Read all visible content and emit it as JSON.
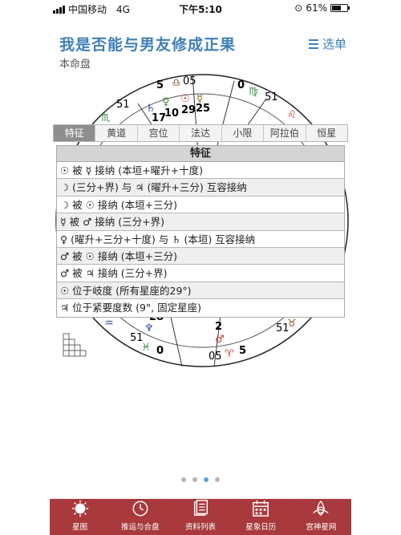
{
  "status_bar": {
    "carrier": "中国移动",
    "network": "4G",
    "time": "下午5:10",
    "battery": "61%",
    "battery_level": 0.61
  },
  "header": {
    "title": "我是否能与男友修成正果",
    "subtitle": "本命盘",
    "menu_label": "选单"
  },
  "chart": {
    "numbers": [
      "5",
      "05",
      "0",
      "51",
      "10",
      "17",
      "29",
      "25",
      "51",
      "51",
      "28",
      "2",
      "0",
      "05",
      "5",
      "51"
    ],
    "signs": [
      "♎",
      "♍",
      "♌",
      "♏",
      "♒",
      "♓",
      "♈",
      "♉"
    ],
    "planets": [
      "♄",
      "♀",
      "☉",
      "☿",
      "♆",
      "♂"
    ]
  },
  "tabs": [
    "特征",
    "黄道",
    "宫位",
    "法达",
    "小限",
    "阿拉伯",
    "恒星"
  ],
  "table": {
    "header": "特征",
    "rows": [
      "☉ 被 ☿ 接纳 (本垣+曜升+十度)",
      "☽ (三分+界) 与 ♃ (曜升+三分) 互容接纳",
      "☽ 被 ☉ 接纳 (本垣+三分)",
      "☿ 被 ♂ 接纳 (三分+界)",
      "♀ (曜升+三分+十度) 与 ♄ (本垣) 互容接纳",
      "♂ 被 ☉ 接纳 (本垣+三分)",
      "♂ 被 ♃ 接纳 (三分+界)",
      "☉ 位于岐度 (所有星座的29°)",
      "♃ 位于紧要度数 (9°, 固定星座)"
    ]
  },
  "pagination": {
    "active_index": 2,
    "count": 4
  },
  "bottom_nav": [
    {
      "label": "星图",
      "icon": "sun-icon"
    },
    {
      "label": "推运与合盘",
      "icon": "clock-icon"
    },
    {
      "label": "资料列表",
      "icon": "document-icon"
    },
    {
      "label": "星象日历",
      "icon": "calendar-icon"
    },
    {
      "label": "宫神星网",
      "icon": "triquetra-icon"
    }
  ],
  "colors": {
    "accent": "#3f7fb8",
    "nav_bg": "#a8393d",
    "dot_active": "#5aa6d6",
    "sign_brown": "#8b5a1e",
    "sign_green": "#3b8a3b",
    "sign_red": "#c8402a",
    "sign_blue": "#2c4fa1"
  }
}
